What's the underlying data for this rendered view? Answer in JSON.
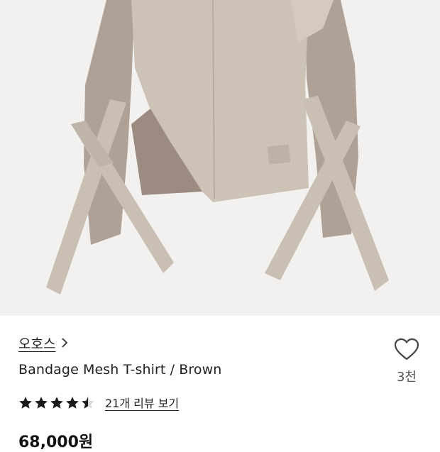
{
  "product": {
    "brand_label": "오호스",
    "title": "Bandage Mesh T-shirt / Brown",
    "rating_value": 4.5,
    "review_link_label": "21개 리뷰 보기",
    "like_count": "3천",
    "price": "68,000원"
  },
  "icons": {
    "brand_chevron": "chevron-right-icon",
    "like": "heart-outline-icon",
    "star": "star-icon"
  },
  "colors": {
    "star_fill": "#1a1a1a",
    "heart_stroke": "#444444",
    "garment_body": "#c7bcaf",
    "garment_mesh": "#a8988c",
    "image_background": "#f2f1ef"
  }
}
